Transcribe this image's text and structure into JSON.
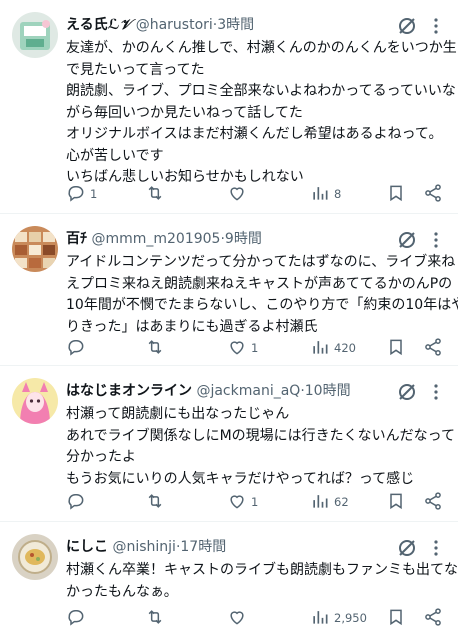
{
  "tweets": [
    {
      "name": "える氏",
      "name_suffix": "ℒ𝒱",
      "handle": "@harustori",
      "time": "3時間",
      "lines": [
        "友達が、かのんくん推しで、村瀬くんのかのんくんをいつか生",
        "で見たいって言ってた",
        "朗読劇、ライブ、プロミ全部来ないよねわかってるっていいな",
        "がら毎回いつか見たいねって話してた",
        "オリジナルボイスはまだ村瀬くんだし希望はあるよねって。",
        "心が苦しいです",
        "いちばん悲しいお知らせかもしれない"
      ],
      "replies": "1",
      "retweets": "",
      "likes": "",
      "views": "8"
    },
    {
      "name": "百ﾁ",
      "name_suffix": "",
      "handle": "@mmm_m201905",
      "time": "9時間",
      "lines": [
        "アイドルコンテンツだって分かってたはずなのに、ライブ来ね",
        "えプロミ来ねえ朗読劇来ねえキャストが声あててるかのんPの",
        "10年間が不憫でたまらないし、このやり方で「約束の10年はや",
        "りきった」はあまりにも過ぎるよ村瀬氏"
      ],
      "replies": "",
      "retweets": "",
      "likes": "1",
      "views": "420"
    },
    {
      "name": "はなじまオンライン",
      "name_suffix": "",
      "handle": "@jackmani_aQ",
      "time": "10時間",
      "lines": [
        "村瀬って朗読劇にも出なったじゃん",
        "あれでライブ関係なしにMの現場には行きたくないんだなって",
        "分かったよ",
        "もうお気にいりの人気キャラだけやってれば？って感じ"
      ],
      "replies": "",
      "retweets": "",
      "likes": "1",
      "views": "62"
    },
    {
      "name": "にしこ",
      "name_suffix": "",
      "handle": "@nishinji",
      "time": "17時間",
      "lines": [
        "村瀬くん卒業！キャストのライブも朗読劇もファンミも出てな",
        "かったもんなぁ。"
      ],
      "replies": "",
      "retweets": "",
      "likes": "",
      "views": "2,950"
    }
  ],
  "separator": "·",
  "colors": {
    "text": "#0f1419",
    "secondary": "#536471",
    "divider": "#eff3f4"
  },
  "icons": [
    "grok-icon",
    "more-icon",
    "reply-icon",
    "retweet-icon",
    "like-icon",
    "views-icon",
    "bookmark-icon",
    "share-icon"
  ]
}
